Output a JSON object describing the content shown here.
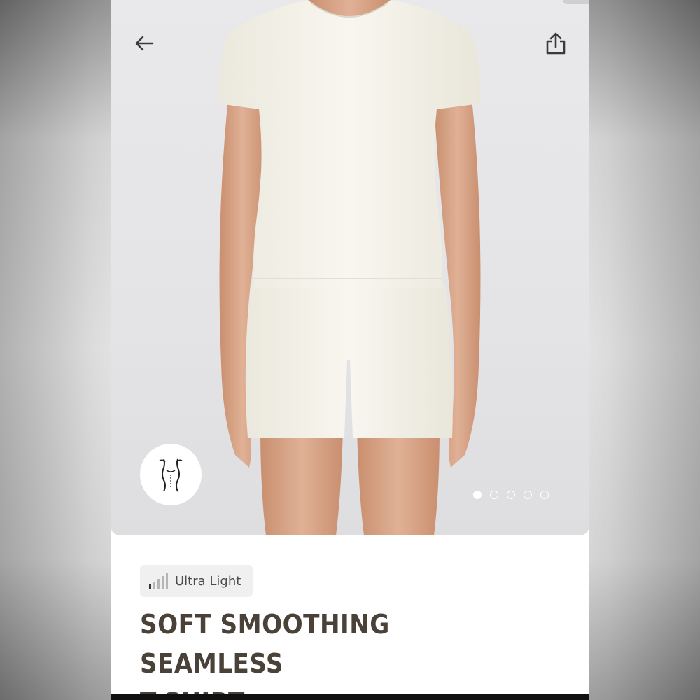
{
  "header": {
    "back_icon": "arrow-left-icon",
    "share_icon": "share-icon"
  },
  "gallery": {
    "fit_icon": "body-silhouette-icon",
    "total_images": 5,
    "active_index": 0
  },
  "product": {
    "weight_icon": "signal-bars-icon",
    "weight_label": "Ultra Light",
    "title_line1": "SOFT SMOOTHING SEAMLESS",
    "title_line2": "T-SHIRT"
  },
  "colors": {
    "title": "#4a4238",
    "hero_bg": "#e6e6e8",
    "garment": "#f5f3ea",
    "skin": "#d9a98a"
  }
}
